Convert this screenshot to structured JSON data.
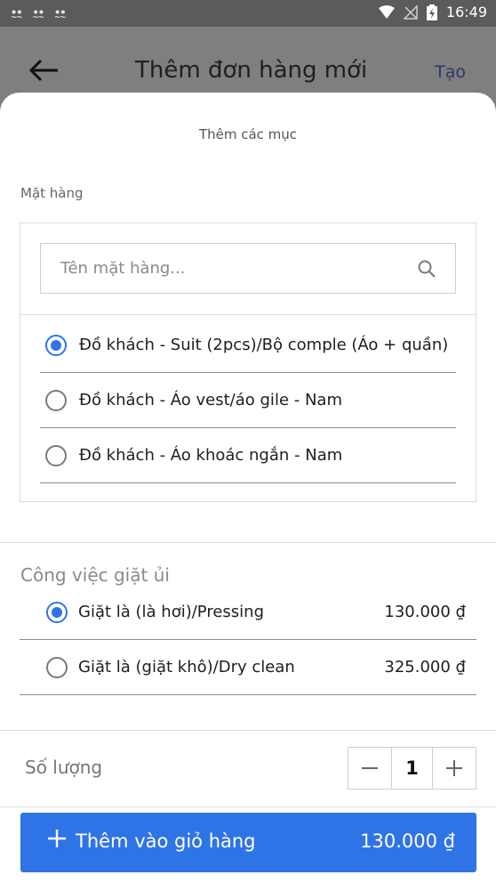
{
  "status_bar": {
    "left_icons": [
      "sync-icon",
      "sync-icon",
      "sync-icon"
    ],
    "left_glyph": "ꔸ",
    "time": "16:49"
  },
  "header": {
    "title": "Thêm đơn hàng mới",
    "action_label": "Tạo"
  },
  "sheet": {
    "title": "Thêm các mục",
    "items_section": {
      "label": "Mặt hàng",
      "search_placeholder": "Tên mặt hàng...",
      "options": [
        {
          "label": "Đồ khách - Suit (2pcs)/Bộ comple (Áo + quần)",
          "selected": true
        },
        {
          "label": "Đồ khách - Áo vest/áo gile - Nam",
          "selected": false
        },
        {
          "label": "Đồ khách - Áo khoác ngắn - Nam",
          "selected": false
        }
      ]
    },
    "services_section": {
      "label": "Công việc giặt ủi",
      "options": [
        {
          "label": "Giặt là (là hơi)/Pressing",
          "price": "130.000 ₫",
          "selected": true
        },
        {
          "label": "Giặt là (giặt khô)/Dry clean",
          "price": "325.000 ₫",
          "selected": false
        }
      ]
    },
    "quantity": {
      "label": "Số lượng",
      "value": "1"
    },
    "add_to_cart": {
      "label": "Thêm vào giỏ hàng",
      "total": "130.000 ₫"
    }
  },
  "colors": {
    "accent": "#2f74e6",
    "header_bg": "#7f7f7f",
    "status_bar_bg": "#5b5b5b",
    "header_action": "#26396a"
  }
}
